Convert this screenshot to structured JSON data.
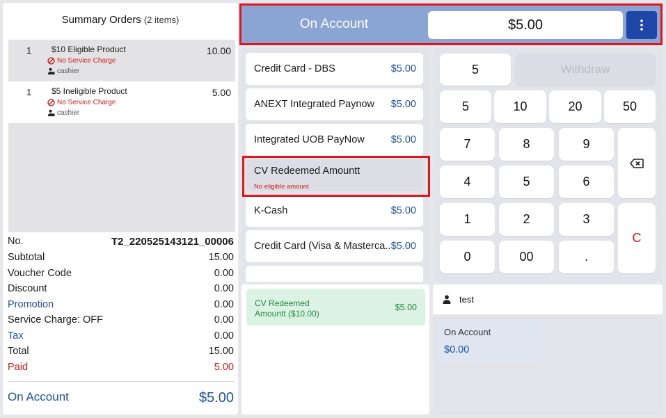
{
  "summary": {
    "title": "Summary Orders",
    "count": "(2 items)",
    "orders": [
      {
        "qty": "1",
        "name": "$10 Eligible Product",
        "price": "10.00",
        "note": "No Service Charge",
        "staff": "cashier"
      },
      {
        "qty": "1",
        "name": "$5 Ineligible Product",
        "price": "5.00",
        "note": "No Service Charge",
        "staff": "cashier"
      }
    ],
    "rows": [
      {
        "label": "No.",
        "value": "T2_220525143121_00006"
      },
      {
        "label": "Subtotal",
        "value": "15.00"
      },
      {
        "label": "Voucher Code",
        "value": "0.00"
      },
      {
        "label": "Discount",
        "value": "0.00"
      },
      {
        "label": "Promotion",
        "value": "0.00"
      },
      {
        "label": "Service Charge: OFF",
        "value": "0.00"
      },
      {
        "label": "Tax",
        "value": "0.00"
      },
      {
        "label": "Total",
        "value": "15.00"
      },
      {
        "label": "Paid",
        "value": "5.00"
      }
    ],
    "on_account_label": "On Account",
    "on_account_value": "$5.00"
  },
  "topbar": {
    "title": "On Account",
    "amount": "$5.00",
    "more_icon": "more-vertical-icon"
  },
  "methods": [
    {
      "name": "Credit Card - DBS",
      "amount": "$5.00"
    },
    {
      "name": "ANEXT Integrated Paynow",
      "amount": "$5.00"
    },
    {
      "name": "Integrated UOB PayNow",
      "amount": "$5.00"
    },
    {
      "name": "CV Redeemed Amountt",
      "sub": "No eligible amount"
    },
    {
      "name": "K-Cash",
      "amount": "$5.00"
    },
    {
      "name": "Credit Card (Visa & Masterca..",
      "amount": "$5.00"
    }
  ],
  "paid": [
    {
      "name_line1": "CV Redeemed",
      "name_line2": "Amountt ($10.00)",
      "amount": "$5.00"
    }
  ],
  "keypad": {
    "display": "5",
    "withdraw": "Withdraw",
    "quick": [
      "5",
      "10",
      "20",
      "50"
    ],
    "digits": [
      "7",
      "8",
      "9",
      "4",
      "5",
      "6",
      "1",
      "2",
      "3",
      "0",
      "00",
      "."
    ],
    "clear": "C",
    "backspace_icon": "backspace-icon"
  },
  "user": {
    "name": "test",
    "account_label": "On Account",
    "account_value": "$0.00"
  },
  "colors": {
    "accent_blue": "#1d53a5",
    "topbar_blue": "#8aa4d4",
    "button_blue": "#1f47a8",
    "highlight_red": "#e3141b",
    "paid_green_bg": "#dcf2e3",
    "paid_green_text": "#1e8a45"
  }
}
